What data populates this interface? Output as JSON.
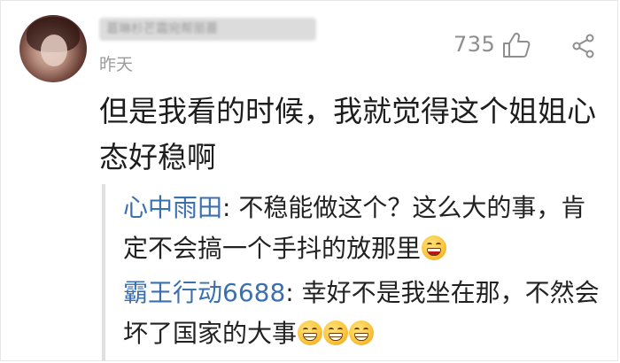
{
  "header": {
    "username": "葛琳杉芒霜宛帮丽蔷",
    "time": "昨天",
    "likes": "735"
  },
  "comment": {
    "text": "但是我看的时候，我就觉得这个姐姐心态好稳啊"
  },
  "replies": [
    {
      "name": "心中雨田",
      "separator": ":",
      "text": " 不稳能做这个？这么大的事，肯定不会搞一个手抖的放那里",
      "emojis": [
        "laugh"
      ]
    },
    {
      "name": "霸王行动6688",
      "separator": ":",
      "text": " 幸好不是我坐在那，不然会坏了国家的大事",
      "emojis": [
        "grin",
        "grin",
        "grin"
      ]
    }
  ],
  "icons": {
    "like": "thumbs-up-icon",
    "share": "share-icon"
  },
  "colors": {
    "reply_name": "#3a6fb0",
    "muted": "#9b9b9b",
    "text": "#1d1d1d"
  }
}
